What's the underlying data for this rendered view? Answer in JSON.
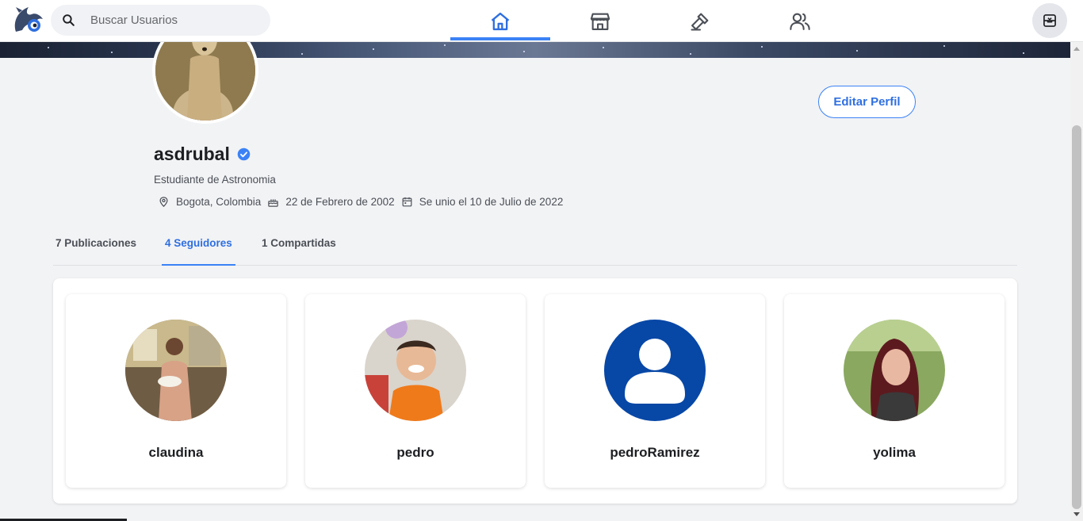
{
  "search": {
    "placeholder": "Buscar Usuarios"
  },
  "nav": [
    "home-icon",
    "store-icon",
    "hammer-icon",
    "users-icon"
  ],
  "profile": {
    "name": "asdrubal",
    "bio": "Estudiante de Astronomia",
    "location": "Bogota, Colombia",
    "birthday": "22 de Febrero de 2002",
    "joined": "Se unio el 10 de Julio de 2022",
    "edit_label": "Editar Perfil"
  },
  "tabs": [
    {
      "label": "7 Publicaciones"
    },
    {
      "label": "4 Seguidores"
    },
    {
      "label": "1 Compartidas"
    }
  ],
  "followers": [
    {
      "name": "claudina"
    },
    {
      "name": "pedro"
    },
    {
      "name": "pedroRamirez"
    },
    {
      "name": "yolima"
    }
  ],
  "colors": {
    "accent": "#3b82f6",
    "default_avatar_bg": "#0747a6"
  }
}
